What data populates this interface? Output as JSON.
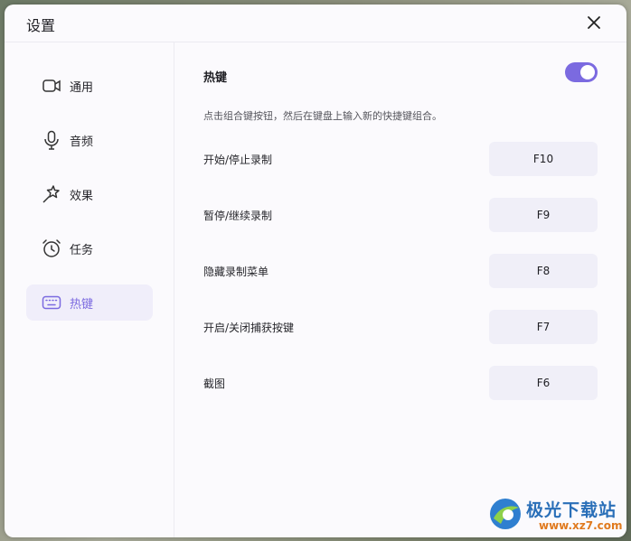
{
  "window": {
    "title": "设置",
    "close_icon": "close-icon"
  },
  "sidebar": {
    "items": [
      {
        "label": "通用",
        "icon": "camera-icon",
        "active": false
      },
      {
        "label": "音频",
        "icon": "microphone-icon",
        "active": false
      },
      {
        "label": "效果",
        "icon": "magic-wand-icon",
        "active": false
      },
      {
        "label": "任务",
        "icon": "alarm-clock-icon",
        "active": false
      },
      {
        "label": "热键",
        "icon": "keyboard-icon",
        "active": true
      }
    ]
  },
  "hotkeys": {
    "title": "热键",
    "enabled": true,
    "hint": "点击组合键按钮，然后在键盘上输入新的快捷键组合。",
    "rows": [
      {
        "label": "开始/停止录制",
        "key": "F10"
      },
      {
        "label": "暂停/继续录制",
        "key": "F9"
      },
      {
        "label": "隐藏录制菜单",
        "key": "F8"
      },
      {
        "label": "开启/关闭捕获按键",
        "key": "F7"
      },
      {
        "label": "截图",
        "key": "F6"
      }
    ]
  },
  "watermark": {
    "title": "极光下载站",
    "url": "www.xz7.com"
  },
  "colors": {
    "accent": "#7b6ae0",
    "active_bg": "#f0eefa",
    "key_bg": "#f0eff8"
  }
}
